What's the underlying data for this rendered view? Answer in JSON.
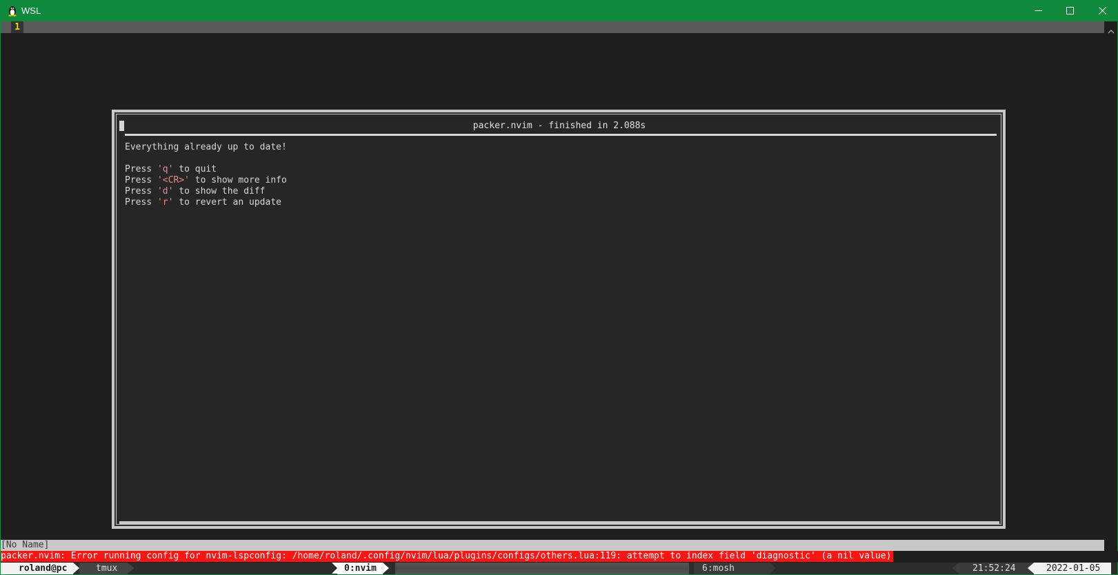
{
  "window": {
    "title": "WSL",
    "accent_color": "#0f8a3c",
    "icons": [
      "linux-penguin-icon",
      "minimize-icon",
      "maximize-icon",
      "close-icon"
    ]
  },
  "tabline": {
    "tab_number": "1"
  },
  "packer": {
    "title": "packer.nvim - finished in 2.088s",
    "status_message": "Everything already up to date!",
    "hints": [
      {
        "prefix": "Press ",
        "key": "'q'",
        "suffix": " to quit"
      },
      {
        "prefix": "Press ",
        "key": "'<CR>'",
        "suffix": " to show more info"
      },
      {
        "prefix": "Press ",
        "key": "'d'",
        "suffix": " to show the diff"
      },
      {
        "prefix": "Press ",
        "key": "'r'",
        "suffix": " to revert an update"
      }
    ]
  },
  "nvim": {
    "buffer_name": "[No Name]",
    "error_message": "packer.nvim: Error running config for nvim-lspconfig: /home/roland/.config/nvim/lua/plugins/configs/others.lua:119: attempt to index field 'diagnostic' (a nil value)",
    "error_color": "#ff1414"
  },
  "tmux": {
    "user": "roland@pc",
    "session": "tmux",
    "active_window": "0:nvim",
    "other_window": "6:mosh",
    "time": "21:52:24",
    "date": "2022-01-05",
    "icons": [
      "user-icon",
      "session-icon",
      "clock-icon",
      "calendar-icon"
    ]
  }
}
